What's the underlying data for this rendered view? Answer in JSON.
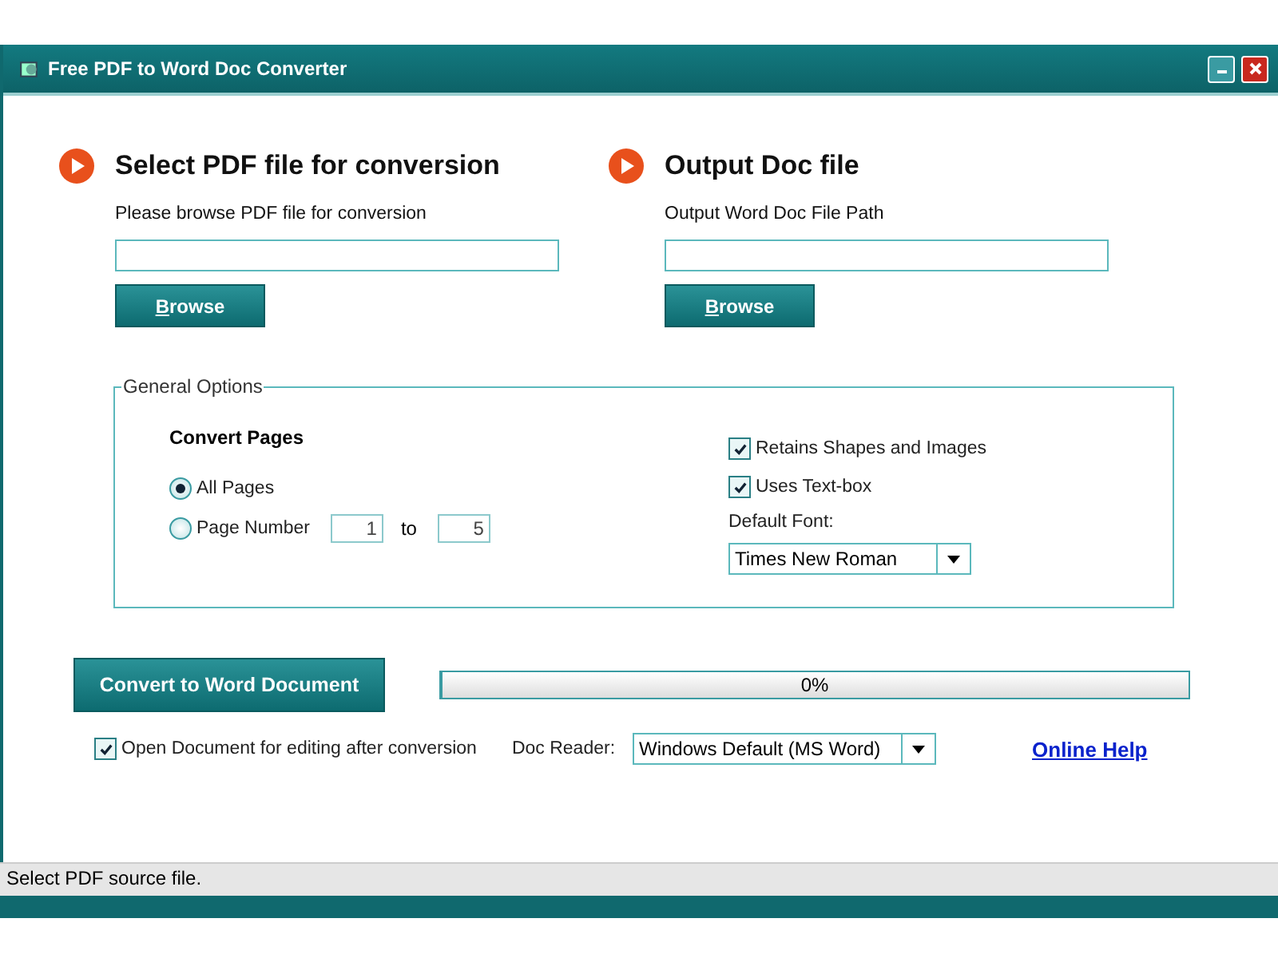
{
  "window": {
    "title": "Free PDF to Word Doc Converter"
  },
  "input_section": {
    "heading": "Select PDF file for conversion",
    "label": "Please browse PDF file for conversion",
    "button": "Browse"
  },
  "output_section": {
    "heading": "Output Doc file",
    "label": "Output Word Doc File Path",
    "button": "Browse"
  },
  "general_options": {
    "title": "General Options",
    "convert_pages": {
      "heading": "Convert Pages",
      "options": [
        {
          "label": "All Pages",
          "selected": true
        },
        {
          "label": "Page Number",
          "selected": false
        }
      ],
      "from": "1",
      "to_label": "to",
      "to": "5"
    },
    "checkboxes": [
      {
        "label": "Retains Shapes and Images",
        "checked": true
      },
      {
        "label": "Uses Text-box",
        "checked": true
      }
    ],
    "default_font": {
      "label": "Default Font:",
      "value": "Times New Roman"
    }
  },
  "convert_button": "Convert to Word Document",
  "progress": {
    "level": 0,
    "text": "0%"
  },
  "open_after": {
    "label": "Open Document for editing after conversion",
    "checked": true
  },
  "doc_reader": {
    "label": "Doc Reader:",
    "value": "Windows Default (MS Word)"
  },
  "online_help": "Online Help",
  "status_bar": "Select PDF source file."
}
